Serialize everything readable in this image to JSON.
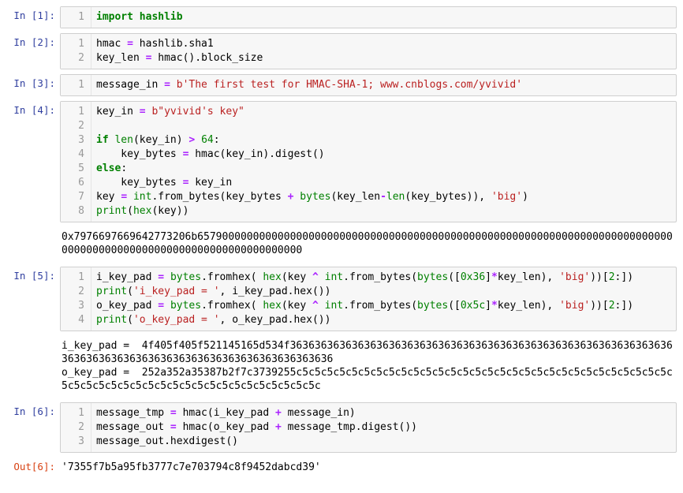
{
  "cells": [
    {
      "in_prompt": "In [1]:",
      "code": [
        [
          {
            "t": "import",
            "c": "tok-kw"
          },
          {
            "t": " "
          },
          {
            "t": "hashlib",
            "c": "tok-kw"
          }
        ]
      ]
    },
    {
      "in_prompt": "In [2]:",
      "code": [
        [
          {
            "t": "hmac "
          },
          {
            "t": "=",
            "c": "tok-op"
          },
          {
            "t": " hashlib.sha1"
          }
        ],
        [
          {
            "t": "key_len "
          },
          {
            "t": "=",
            "c": "tok-op"
          },
          {
            "t": " hmac().block_size"
          }
        ]
      ]
    },
    {
      "in_prompt": "In [3]:",
      "code": [
        [
          {
            "t": "message_in "
          },
          {
            "t": "=",
            "c": "tok-op"
          },
          {
            "t": " "
          },
          {
            "t": "b'The first test for HMAC-SHA-1; www.cnblogs.com/yvivid'",
            "c": "tok-bstr"
          }
        ]
      ]
    },
    {
      "in_prompt": "In [4]:",
      "code": [
        [
          {
            "t": "key_in "
          },
          {
            "t": "=",
            "c": "tok-op"
          },
          {
            "t": " "
          },
          {
            "t": "b\"yvivid's key\"",
            "c": "tok-bstr"
          }
        ],
        [
          {
            "t": ""
          }
        ],
        [
          {
            "t": "if",
            "c": "tok-kw"
          },
          {
            "t": " "
          },
          {
            "t": "len",
            "c": "tok-builtin"
          },
          {
            "t": "(key_in) "
          },
          {
            "t": ">",
            "c": "tok-op"
          },
          {
            "t": " "
          },
          {
            "t": "64",
            "c": "tok-num"
          },
          {
            "t": ":"
          }
        ],
        [
          {
            "t": "    key_bytes "
          },
          {
            "t": "=",
            "c": "tok-op"
          },
          {
            "t": " hmac(key_in).digest()"
          }
        ],
        [
          {
            "t": "else",
            "c": "tok-kw"
          },
          {
            "t": ":"
          }
        ],
        [
          {
            "t": "    key_bytes "
          },
          {
            "t": "=",
            "c": "tok-op"
          },
          {
            "t": " key_in"
          }
        ],
        [
          {
            "t": "key "
          },
          {
            "t": "=",
            "c": "tok-op"
          },
          {
            "t": " "
          },
          {
            "t": "int",
            "c": "tok-builtin"
          },
          {
            "t": ".from_bytes(key_bytes "
          },
          {
            "t": "+",
            "c": "tok-op"
          },
          {
            "t": " "
          },
          {
            "t": "bytes",
            "c": "tok-builtin"
          },
          {
            "t": "(key_len"
          },
          {
            "t": "-",
            "c": "tok-op"
          },
          {
            "t": "len",
            "c": "tok-builtin"
          },
          {
            "t": "(key_bytes)), "
          },
          {
            "t": "'big'",
            "c": "tok-str"
          },
          {
            "t": ")"
          }
        ],
        [
          {
            "t": "print",
            "c": "tok-builtin"
          },
          {
            "t": "("
          },
          {
            "t": "hex",
            "c": "tok-builtin"
          },
          {
            "t": "(key))"
          }
        ]
      ],
      "output": "0x797669766964277320​6b65790000000000000000000000000000000000000000000000000000000000000000000000000000000000000000000000000000000000000000"
    },
    {
      "in_prompt": "In [5]:",
      "code": [
        [
          {
            "t": "i_key_pad "
          },
          {
            "t": "=",
            "c": "tok-op"
          },
          {
            "t": " "
          },
          {
            "t": "bytes",
            "c": "tok-builtin"
          },
          {
            "t": ".fromhex( "
          },
          {
            "t": "hex",
            "c": "tok-builtin"
          },
          {
            "t": "(key "
          },
          {
            "t": "^",
            "c": "tok-op"
          },
          {
            "t": " "
          },
          {
            "t": "int",
            "c": "tok-builtin"
          },
          {
            "t": ".from_bytes("
          },
          {
            "t": "bytes",
            "c": "tok-builtin"
          },
          {
            "t": "(["
          },
          {
            "t": "0x36",
            "c": "tok-hex"
          },
          {
            "t": "]"
          },
          {
            "t": "*",
            "c": "tok-op"
          },
          {
            "t": "key_len), "
          },
          {
            "t": "'big'",
            "c": "tok-str"
          },
          {
            "t": "))["
          },
          {
            "t": "2",
            "c": "tok-num"
          },
          {
            "t": ":])"
          }
        ],
        [
          {
            "t": "print",
            "c": "tok-builtin"
          },
          {
            "t": "("
          },
          {
            "t": "'i_key_pad = '",
            "c": "tok-str"
          },
          {
            "t": ", i_key_pad.hex())"
          }
        ],
        [
          {
            "t": "o_key_pad "
          },
          {
            "t": "=",
            "c": "tok-op"
          },
          {
            "t": " "
          },
          {
            "t": "bytes",
            "c": "tok-builtin"
          },
          {
            "t": ".fromhex( "
          },
          {
            "t": "hex",
            "c": "tok-builtin"
          },
          {
            "t": "(key "
          },
          {
            "t": "^",
            "c": "tok-op"
          },
          {
            "t": " "
          },
          {
            "t": "int",
            "c": "tok-builtin"
          },
          {
            "t": ".from_bytes("
          },
          {
            "t": "bytes",
            "c": "tok-builtin"
          },
          {
            "t": "(["
          },
          {
            "t": "0x5c",
            "c": "tok-hex"
          },
          {
            "t": "]"
          },
          {
            "t": "*",
            "c": "tok-op"
          },
          {
            "t": "key_len), "
          },
          {
            "t": "'big'",
            "c": "tok-str"
          },
          {
            "t": "))["
          },
          {
            "t": "2",
            "c": "tok-num"
          },
          {
            "t": ":])"
          }
        ],
        [
          {
            "t": "print",
            "c": "tok-builtin"
          },
          {
            "t": "("
          },
          {
            "t": "'o_key_pad = '",
            "c": "tok-str"
          },
          {
            "t": ", o_key_pad.hex())"
          }
        ]
      ],
      "output": "i_key_pad =  4f405f405f521145165d534f3636363636363636363636363636363636363636363636363636363636363636363636363636363636363636363636363636363636\no_key_pad =  252a352a35387b2f7c3739255c5c5c5c5c5c5c5c5c5c5c5c5c5c5c5c5c5c5c5c5c5c5c5c5c5c5c5c5c5c5c5c5c5c5c5c5c5c5c5c5c5c5c5c5c5c5c5c5c5c5c5c"
    },
    {
      "in_prompt": "In [6]:",
      "code": [
        [
          {
            "t": "message_tmp "
          },
          {
            "t": "=",
            "c": "tok-op"
          },
          {
            "t": " hmac(i_key_pad "
          },
          {
            "t": "+",
            "c": "tok-op"
          },
          {
            "t": " message_in)"
          }
        ],
        [
          {
            "t": "message_out "
          },
          {
            "t": "=",
            "c": "tok-op"
          },
          {
            "t": " hmac(o_key_pad "
          },
          {
            "t": "+",
            "c": "tok-op"
          },
          {
            "t": " message_tmp.digest())"
          }
        ],
        [
          {
            "t": "message_out.hexdigest()"
          }
        ]
      ],
      "out_prompt": "Out[6]:",
      "result": "'7355f7b5a95fb3777c7e703794c8f9452dabcd39'"
    }
  ]
}
